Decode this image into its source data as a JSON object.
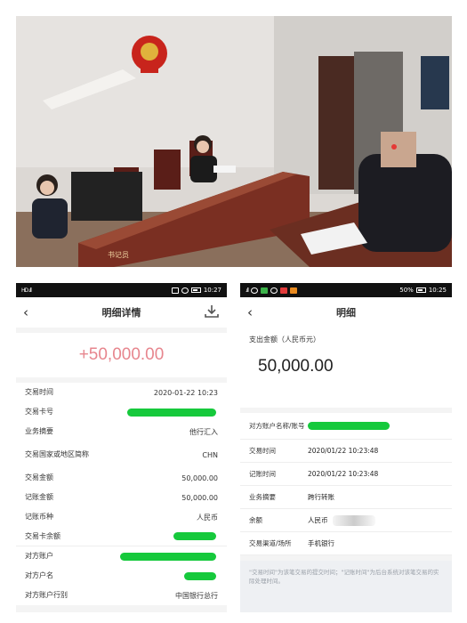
{
  "photo": {
    "clerk_sign": "书记员"
  },
  "left_screen": {
    "status_time": "10:27",
    "status_signal": "HD .ıll",
    "title": "明细详情",
    "back_icon": "back-chevron-icon",
    "download_icon": "download-icon",
    "amount": "+50,000.00",
    "rows": [
      {
        "label": "交易时间",
        "value": "2020-01-22 10:23"
      },
      {
        "label": "交易卡号",
        "value": ""
      },
      {
        "label": "业务摘要",
        "value": "他行汇入"
      },
      {
        "label": "交易国家或地区简称",
        "value": "CHN"
      },
      {
        "label": "交易金额",
        "value": "50,000.00"
      },
      {
        "label": "记账金额",
        "value": "50,000.00"
      },
      {
        "label": "记账币种",
        "value": "人民币"
      },
      {
        "label": "交易卡余额",
        "value": ""
      },
      {
        "label": "对方账户",
        "value": ""
      },
      {
        "label": "对方户名",
        "value": ""
      },
      {
        "label": "对方账户行别",
        "value": "中国银行总行"
      }
    ]
  },
  "right_screen": {
    "status_time": "10:25",
    "status_battery": "50%",
    "title": "明细",
    "back_icon": "back-chevron-icon",
    "amount_caption": "支出金额（人民币元）",
    "amount": "50,000.00",
    "rows": [
      {
        "label": "对方账户名称/账号",
        "value": ""
      },
      {
        "label": "交易时间",
        "value": "2020/01/22  10:23:48"
      },
      {
        "label": "记账时间",
        "value": "2020/01/22  10:23:48"
      },
      {
        "label": "业务摘要",
        "value": "跨行转账"
      },
      {
        "label": "余额",
        "value": "人民币"
      },
      {
        "label": "交易渠道/场所",
        "value": "手机银行"
      }
    ],
    "note": "\"交易时间\"为该笔交易的提交时间；\"记账时间\"为后台系统对该笔交易的实际处理时间。"
  },
  "colors": {
    "amount_positive": "#e7868e",
    "mask_green": "#16c93c",
    "status_bar": "#111111"
  }
}
